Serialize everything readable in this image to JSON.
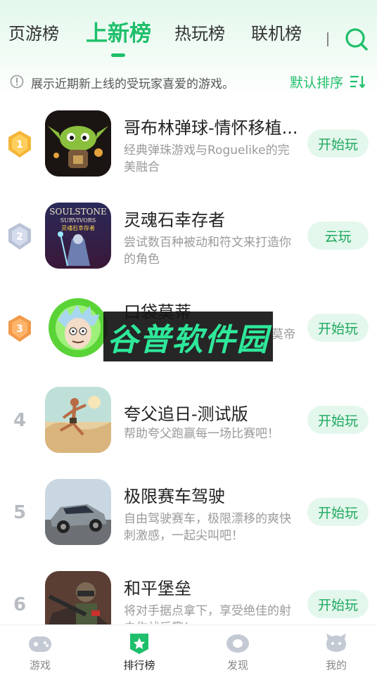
{
  "tabs": [
    {
      "label": "页游榜",
      "active": false
    },
    {
      "label": "上新榜",
      "active": true
    },
    {
      "label": "热玩榜",
      "active": false
    },
    {
      "label": "联机榜",
      "active": false
    }
  ],
  "info": {
    "text": "展示近期新上线的受玩家喜爱的游戏。",
    "sort_label": "默认排序"
  },
  "games": [
    {
      "rank": "1",
      "title": "哥布林弹球-情怀移植...",
      "desc": "经典弹珠游戏与Roguelike的完美融合",
      "button": "开始玩",
      "medal": "gold",
      "icon": "goblin-icon"
    },
    {
      "rank": "2",
      "title": "灵魂石幸存者",
      "desc": "尝试数百种被动和符文来打造你的角色",
      "button": "云玩",
      "medal": "silver",
      "icon": "soulstone-icon",
      "icon_text": [
        "SOULSTONE",
        "SURVIVORS",
        "灵魂石幸存者"
      ]
    },
    {
      "rank": "3",
      "title": "口袋莫蒂",
      "desc": "莫帝",
      "button": "开始玩",
      "medal": "bronze",
      "icon": "rick-icon"
    },
    {
      "rank": "4",
      "title": "夸父追日-测试版",
      "desc": "帮助夸父跑赢每一场比赛吧！",
      "button": "开始玩",
      "medal": "none",
      "icon": "runner-icon"
    },
    {
      "rank": "5",
      "title": "极限赛车驾驶",
      "desc": "自由驾驶赛车，极限漂移的爽快刺激感，一起尖叫吧！",
      "button": "开始玩",
      "medal": "none",
      "icon": "car-icon"
    },
    {
      "rank": "6",
      "title": "和平堡垒",
      "desc": "将对手据点拿下，享受绝佳的射击作战乐趣！",
      "button": "开始玩",
      "medal": "none",
      "icon": "soldier-icon"
    }
  ],
  "watermark": "谷普软件园",
  "nav": [
    {
      "label": "游戏",
      "active": false
    },
    {
      "label": "排行榜",
      "active": true
    },
    {
      "label": "发现",
      "active": false
    },
    {
      "label": "我的",
      "active": false
    }
  ],
  "colors": {
    "accent": "#1fbf6b",
    "button_bg": "#e4f7ec",
    "gold": "#f5b638",
    "silver": "#b9c3d6",
    "bronze": "#f29a4a"
  }
}
